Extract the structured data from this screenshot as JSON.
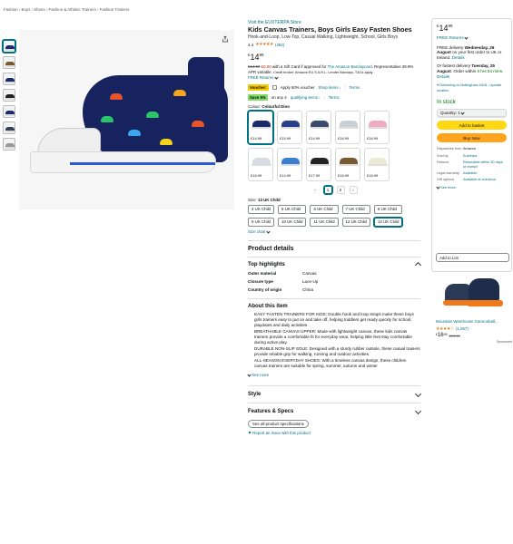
{
  "breadcrumb": "Fashion › Boys › Shoes › Fashion & Athletic Trainers › Fashion Trainers",
  "store_link": "Visit the EUXTERPA Store",
  "title": "Kids Canvas Trainers, Boys Girls Easy Fasten Shoes",
  "subtitle": "Hook-and-Loop, Low-Top, Casual Walking, Lightweight, School, Girls Boys",
  "rating": {
    "value": "4.4",
    "stars": "★★★★★",
    "count": "(392)"
  },
  "price": {
    "currency": "£",
    "whole": "14",
    "fraction": "99"
  },
  "gift_card": {
    "was": "£14.99",
    "now": "£0.00",
    "text": "with a Gift Card if approved for",
    "link": "The Amazon Barclaycard",
    "apr": "Representative 28.9% APR variable.",
    "broker": "Credit broker: Amazon EU S.A.R.L. Lender Barclays. T&Cs apply"
  },
  "free_returns": "FREE Returns",
  "voucher": {
    "badge": "Voucher:",
    "text": "Apply 50% voucher",
    "shop": "Shop items ›",
    "terms": "Terms"
  },
  "save": {
    "badge": "Save 5%",
    "text": "on any 4",
    "link": "qualifying items ›",
    "terms": "Terms"
  },
  "color": {
    "label": "Colour:",
    "value": "Colourful Dino"
  },
  "swatches": [
    {
      "price": "£14.99",
      "color": "#1b2a6b"
    },
    {
      "price": "£15.99",
      "color": "#2d3e8a"
    },
    {
      "price": "£14.99",
      "color": "#3b4b6b"
    },
    {
      "price": "£16.99",
      "color": "#c9cdd6"
    },
    {
      "price": "£16.99",
      "color": "#f2a9c2"
    },
    {
      "price": "£16.99",
      "color": "#d8dbe4"
    },
    {
      "price": "£14.99",
      "color": "#3b7fcf"
    },
    {
      "price": "£17.99",
      "color": "#222"
    },
    {
      "price": "£16.99",
      "color": "#7a5a2f"
    },
    {
      "price": "£16.99",
      "color": "#eee9d6"
    }
  ],
  "pager": {
    "prev": "‹",
    "p1": "1",
    "p2": "2",
    "next": "›"
  },
  "size": {
    "label": "Size:",
    "value": "13 UK Child",
    "chart": "Size chart"
  },
  "sizes": [
    "4 UK Child",
    "5 UK Child",
    "6 UK Child",
    "7 UK Child",
    "8 UK Child",
    "9 UK Child",
    "10 UK Child",
    "11 UK Child",
    "12 UK Child",
    "13 UK Child"
  ],
  "product_details": "Product details",
  "top_highlights": "Top highlights",
  "specs": [
    {
      "k": "Outer material",
      "v": "Canvas"
    },
    {
      "k": "Closure type",
      "v": "Lace-Up"
    },
    {
      "k": "Country of origin",
      "v": "China"
    }
  ],
  "about_title": "About this item",
  "bullets": [
    "EASY FASTEN TRAINERS FOR KIDS: Double hook and loop straps make these boys girls trainers easy to put on and take off, helping toddlers get ready quickly for school, playdates and daily activities.",
    "BREATHABLE CANVAS UPPER: Made with lightweight canvas, these kids canvas trainers provide a comfortable fit for everyday wear, helping little feet stay comfortable during active play.",
    "DURABLE NON-SLIP SOLE: Designed with a sturdy rubber outsole, these casual trainers provide reliable grip for walking, running and outdoor activities.",
    "ALL-SEASON EVERYDAY SHOES: With a timeless canvas design, these children canvas trainers are suitable for spring, summer, autumn and winter"
  ],
  "see_more": "See more",
  "style": "Style",
  "features": "Features & Specs",
  "see_all_specs": "See all product specifications",
  "report": "Report an issue with this product",
  "buybox": {
    "price_whole": "14",
    "price_frac": "99",
    "currency": "£",
    "free_returns": "FREE Returns",
    "delivery": "FREE delivery",
    "delivery_date": "Wednesday, 26 August",
    "delivery_tail": "on your first order to UK or Ireland.",
    "details": "Details",
    "fastest": "Or fastest delivery",
    "fastest_date": "Tuesday, 25 August",
    "order_within": "Order within",
    "countdown": "6 hrs 54 mins.",
    "location": "Delivering to Nottingham NG8 - Update location",
    "in_stock": "In stock",
    "quantity": "Quantity: 1",
    "add_to_basket": "Add to basket",
    "buy_now": "Buy Now",
    "info": [
      {
        "k": "Dispatches from",
        "v": "Amazon"
      },
      {
        "k": "Sold by",
        "v": "Euxterpa"
      },
      {
        "k": "Returns",
        "v": "Returnable within 30 days of receipt"
      },
      {
        "k": "Legal warranty",
        "v": "Available"
      },
      {
        "k": "Gift options",
        "v": "Available at checkout"
      }
    ],
    "see_more": "See more",
    "add_to_list": "Add to List"
  },
  "ad": {
    "title": "Mountain Warehouse Cannonball...",
    "stars": "★★★★☆",
    "count": "(1,067)",
    "price_whole": "16",
    "price_frac": "99",
    "was": "£19.99",
    "sponsored": "Sponsored"
  }
}
